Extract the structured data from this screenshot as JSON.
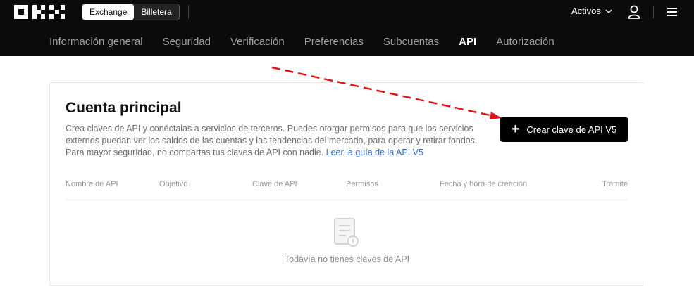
{
  "header": {
    "logo_text": "OKX",
    "toggle": [
      "Exchange",
      "Billetera"
    ],
    "assets_label": "Activos",
    "icons": [
      "chevron-down-icon",
      "user-icon",
      "menu-icon"
    ]
  },
  "subnav": {
    "tabs": [
      "Información general",
      "Seguridad",
      "Verificación",
      "Preferencias",
      "Subcuentas",
      "API",
      "Autorización"
    ],
    "active": "API"
  },
  "card": {
    "title": "Cuenta principal",
    "desc_line1": "Crea claves de API y conéctalas a servicios de terceros. Puedes otorgar permisos para que los servicios",
    "desc_line2": "externos puedan ver los saldos de las cuentas y las tendencias del mercado, para operar y retirar fondos.",
    "desc_line3": "Para mayor seguridad, no compartas tus claves de API con nadie.",
    "guide_link": "Leer la guía de la API V5",
    "create_button": "Crear clave de API V5",
    "columns": [
      "Nombre de API",
      "Objetivo",
      "Clave de API",
      "Permisos",
      "Fecha y hora de creación",
      "Trámite"
    ],
    "empty_text": "Todavía no tienes claves de API"
  },
  "colors": {
    "topbar_bg": "#0b0b0b",
    "accent_link": "#2a6fd6",
    "annotation_arrow": "#e0151b"
  }
}
